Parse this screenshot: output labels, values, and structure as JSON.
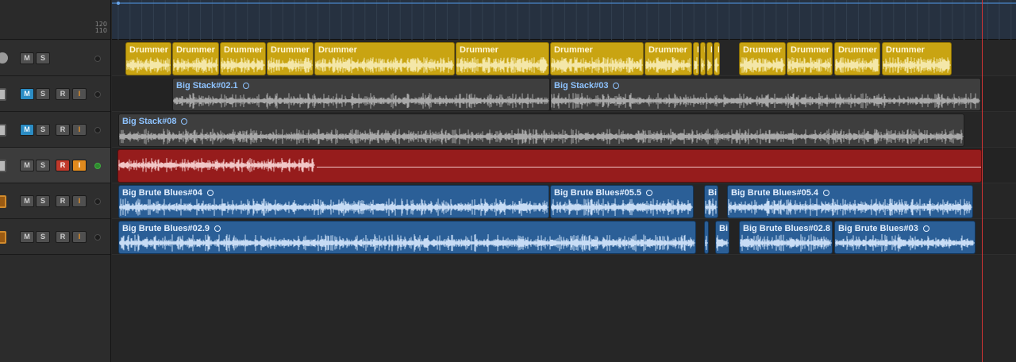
{
  "ruler": {
    "scale_top": "120",
    "scale_bottom": "110"
  },
  "colors": {
    "drummer": "#c9a412",
    "audio_gray": "#3e3e3e",
    "audio_blue": "#2b5f97",
    "recording": "#961c1c",
    "playhead": "#d23434"
  },
  "tracks": [
    {
      "icon": "drum-kit-icon",
      "buttons": [
        "M",
        "S"
      ],
      "m_active": false,
      "r_active": false,
      "i_active": false,
      "led_on": false,
      "selected": false,
      "regions": [
        {
          "name": "Drummer",
          "style": "drummer"
        },
        {
          "name": "Drummer",
          "style": "drummer"
        },
        {
          "name": "Drummer",
          "style": "drummer"
        },
        {
          "name": "Drummer",
          "style": "drummer"
        },
        {
          "name": "Drummer",
          "style": "drummer"
        },
        {
          "name": "Drummer",
          "style": "drummer"
        },
        {
          "name": "Drummer",
          "style": "drummer"
        },
        {
          "name": "Drummer",
          "style": "drummer"
        },
        {
          "name": "D",
          "style": "drummer"
        },
        {
          "name": "D",
          "style": "drummer"
        },
        {
          "name": "D",
          "style": "drummer"
        },
        {
          "name": "D",
          "style": "drummer"
        },
        {
          "name": "Drummer",
          "style": "drummer"
        },
        {
          "name": "Drummer",
          "style": "drummer"
        },
        {
          "name": "Drummer",
          "style": "drummer"
        },
        {
          "name": "Drummer",
          "style": "drummer"
        }
      ]
    },
    {
      "icon": "guitar-amp-icon",
      "buttons": [
        "M",
        "S",
        "R",
        "I"
      ],
      "m_active": true,
      "r_active": false,
      "i_active": false,
      "led_on": false,
      "selected": false,
      "regions": [
        {
          "name": "Big Stack#02.1",
          "style": "gray",
          "loop": true
        },
        {
          "name": "Big Stack#03",
          "style": "gray",
          "loop": true
        }
      ]
    },
    {
      "icon": "guitar-amp-icon",
      "buttons": [
        "M",
        "S",
        "R",
        "I"
      ],
      "m_active": true,
      "r_active": false,
      "i_active": false,
      "led_on": false,
      "selected": false,
      "regions": [
        {
          "name": "Big Stack#08",
          "style": "gray",
          "loop": true
        }
      ]
    },
    {
      "icon": "guitar-amp-icon",
      "buttons": [
        "M",
        "S",
        "R",
        "I"
      ],
      "m_active": false,
      "r_active": true,
      "i_active": true,
      "led_on": true,
      "selected": true,
      "regions": [
        {
          "name": "",
          "style": "red",
          "loop": false
        }
      ]
    },
    {
      "icon": "bass-amp-icon",
      "buttons": [
        "M",
        "S",
        "R",
        "I"
      ],
      "m_active": false,
      "r_active": false,
      "i_active": false,
      "led_on": false,
      "selected": false,
      "regions": [
        {
          "name": "Big Brute Blues#04",
          "style": "blue",
          "loop": true
        },
        {
          "name": "Big Brute Blues#05.5",
          "style": "blue",
          "loop": true
        },
        {
          "name": "Bi",
          "style": "blue",
          "loop": false
        },
        {
          "name": "Big Brute Blues#05.4",
          "style": "blue",
          "loop": true
        }
      ]
    },
    {
      "icon": "bass-amp-icon",
      "buttons": [
        "M",
        "S",
        "R",
        "I"
      ],
      "m_active": false,
      "r_active": false,
      "i_active": false,
      "led_on": false,
      "selected": false,
      "regions": [
        {
          "name": "Big Brute Blues#02.9",
          "style": "blue",
          "loop": true
        },
        {
          "name": "",
          "style": "blue",
          "loop": false
        },
        {
          "name": "Bi",
          "style": "blue",
          "loop": false
        },
        {
          "name": "Big Brute Blues#02.8",
          "style": "blue",
          "loop": false
        },
        {
          "name": "Big Brute Blues#03",
          "style": "blue",
          "loop": true
        }
      ]
    }
  ]
}
